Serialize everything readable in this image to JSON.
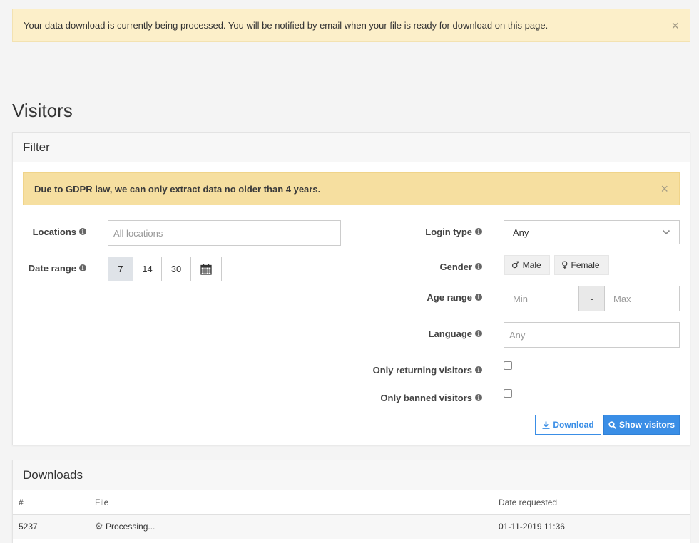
{
  "notice": {
    "message": "Your data download is currently being processed. You will be notified by email when your file is ready for download on this page.",
    "close": "×"
  },
  "page": {
    "title": "Visitors"
  },
  "filter": {
    "heading": "Filter",
    "gdpr_message": "Due to GDPR law, we can only extract data no older than 4 years.",
    "gdpr_close": "×",
    "locations": {
      "label": "Locations",
      "placeholder": "All locations"
    },
    "date_range": {
      "label": "Date range",
      "options": [
        "7",
        "14",
        "30"
      ],
      "selected": "7"
    },
    "login_type": {
      "label": "Login type",
      "value": "Any"
    },
    "gender": {
      "label": "Gender",
      "male": "Male",
      "female": "Female"
    },
    "age_range": {
      "label": "Age range",
      "min_placeholder": "Min",
      "separator": "-",
      "max_placeholder": "Max"
    },
    "language": {
      "label": "Language",
      "placeholder": "Any"
    },
    "returning": {
      "label": "Only returning visitors"
    },
    "banned": {
      "label": "Only banned visitors"
    },
    "download_label": "Download",
    "show_label": "Show visitors",
    "info_glyph": "i"
  },
  "downloads": {
    "heading": "Downloads",
    "columns": [
      "#",
      "File",
      "Date requested"
    ],
    "rows": [
      {
        "id": "5237",
        "file": "Processing...",
        "date": "01-11-2019 11:36"
      }
    ]
  },
  "colors": {
    "accent": "#3a8ee6",
    "notice_bg": "#fcefc9",
    "gdpr_bg": "#f6dfa0"
  }
}
